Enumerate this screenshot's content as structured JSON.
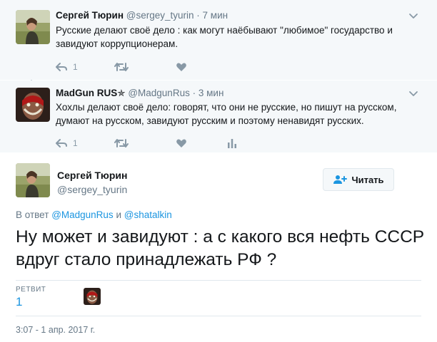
{
  "thread": [
    {
      "author_name": "Сергей Тюрин",
      "author_handle": "@sergey_tyurin",
      "separator": "·",
      "time": "7 мин",
      "text": "Русские делают своё дело : как могут наёбывают \"любимое\" государство и завидуют коррупционерам.",
      "reply_count": "1",
      "avatar_icon": "person-photo-icon"
    },
    {
      "author_name": "MadGun RUS✯",
      "author_handle": "@MadgunRus",
      "separator": "·",
      "time": "3 мин",
      "text": "Хохлы делают своё дело: говорят, что они не русские, но пишут на русском, думают на русском, завидуют русским и поэтому ненавидят русских.",
      "reply_count": "1",
      "avatar_icon": "face-paint-photo-icon"
    }
  ],
  "main": {
    "author_name": "Сергей Тюрин",
    "author_handle": "@sergey_tyurin",
    "follow_label": "Читать",
    "reply_prefix": "В ответ",
    "reply_user1": "@MadgunRus",
    "reply_and": "и",
    "reply_user2": "@shatalkin",
    "text": "Ну может и завидуют : а с какого вся нефть СССР вдруг стало принадлежать РФ ?",
    "retweets_label": "РЕТВИТ",
    "retweets_count": "1",
    "timestamp": "3:07 - 1 апр. 2017 г."
  },
  "colors": {
    "link": "#1b95e0",
    "muted": "#657786",
    "icon": "#8899a6",
    "thread_line": "#ccd6dd",
    "reply_bg": "#f5f8fa"
  }
}
